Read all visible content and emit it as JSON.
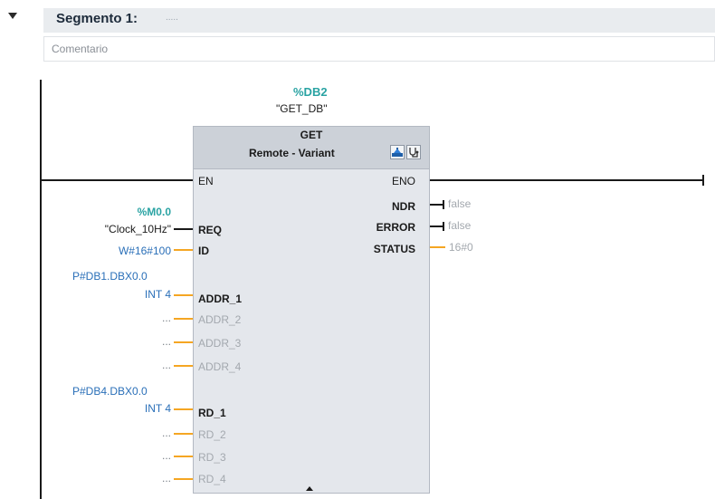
{
  "segment": {
    "title": "Segmento 1:",
    "dots": ".....",
    "comment": "Comentario"
  },
  "instance": {
    "address": "%DB2",
    "name": "\"GET_DB\""
  },
  "block": {
    "title": "GET",
    "subtitle": "Remote - Variant",
    "icons": [
      "config-icon",
      "diagnostics-icon"
    ]
  },
  "inputs": {
    "en": "EN",
    "req": "REQ",
    "id": "ID",
    "addr_1": "ADDR_1",
    "addr_2": "ADDR_2",
    "addr_3": "ADDR_3",
    "addr_4": "ADDR_4",
    "rd_1": "RD_1",
    "rd_2": "RD_2",
    "rd_3": "RD_3",
    "rd_4": "RD_4"
  },
  "outputs": {
    "eno": "ENO",
    "ndr": "NDR",
    "error": "ERROR",
    "status": "STATUS"
  },
  "operands": {
    "req_address": "%M0.0",
    "req_name": "\"Clock_10Hz\"",
    "id_value": "W#16#100",
    "addr_1_pointer": "P#DB1.DBX0.0",
    "addr_1_type": "INT 4",
    "addr_2": "...",
    "addr_3": "...",
    "addr_4": "...",
    "rd_1_pointer": "P#DB4.DBX0.0",
    "rd_1_type": "INT 4",
    "rd_2": "...",
    "rd_3": "...",
    "rd_4": "..."
  },
  "output_values": {
    "ndr": "false",
    "error": "false",
    "status": "16#0"
  },
  "colors": {
    "address_teal": "#2aa3a3",
    "constant_blue": "#2a6fb8",
    "wire_orange": "#f5a623",
    "block_bg": "#e4e7ec"
  }
}
